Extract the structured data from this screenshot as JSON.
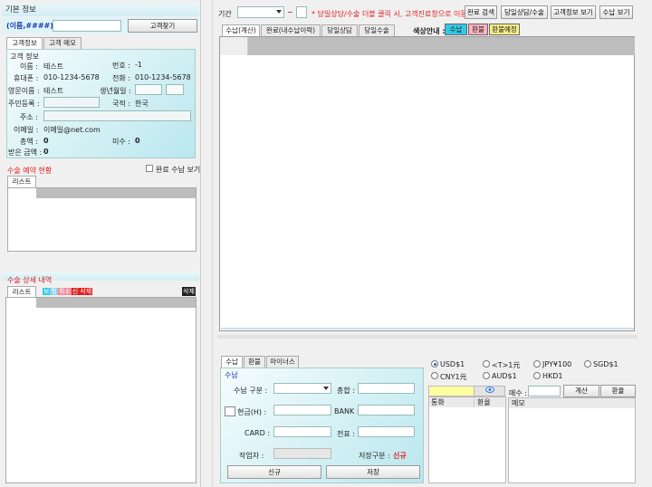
{
  "left": {
    "basic_info_title": "기본 정보",
    "search_placeholder_label": "(이름,####)",
    "customer_search_btn": "고객찾기",
    "tabs": [
      "고객정보",
      "고객 메모"
    ],
    "customer_info_title": "고객 정보",
    "fields": {
      "name_label": "이름 :",
      "name_value": "테스트",
      "no_label": "번호 :",
      "no_value": "-1",
      "mobile_label": "휴대폰 :",
      "mobile_value": "010-1234-5678",
      "phone_label": "전화 :",
      "phone_value": "010-1234-5678",
      "eng_name_label": "영문이름 :",
      "eng_name_value": "테스트",
      "birth_label": "생년월일 :",
      "resident_label": "주민등록 :",
      "nation_label": "국적 :",
      "nation_value": "한국",
      "address_label": "주소 :",
      "email_label": "이메일 :",
      "email_value": "이메일@net.com",
      "total_label": "총액 :",
      "total_value": "0",
      "unpaid_label": "미수 :",
      "unpaid_value": "0",
      "received_label": "받은 금액 :",
      "received_value": "0"
    },
    "reservation_title": "수술 예약 현황",
    "show_completed_label": "완료 수납 보기",
    "list_tab": "리스트",
    "detail_title": "수술 상세 내역",
    "detail_tab": "리스트",
    "detail_tags": [
      "보",
      "험",
      "취소",
      "신",
      "삭제"
    ],
    "detail_right_tag": "삭제"
  },
  "toolbar": {
    "period_label": "기간",
    "tilde": "~",
    "notice": "* 당일상담/수술 더블 클릭 시, 고객진료창으로 이동",
    "buttons": [
      "완료 검색",
      "당일상담/수술",
      "고객정보 보기",
      "수납 보기"
    ]
  },
  "main": {
    "tabs": [
      "수납(계산)",
      "완료(내수납이력)",
      "당일상담",
      "당일수술"
    ],
    "color_legend_label": "색상안내 :",
    "legend": [
      {
        "label": "수납",
        "color": "#33c8e6"
      },
      {
        "label": "환불",
        "color": "#ffb3c1"
      },
      {
        "label": "환불예정",
        "color": "#f5f08a"
      }
    ]
  },
  "payment": {
    "tabs": [
      "수납",
      "환불",
      "마이너스"
    ],
    "section_title": "수납",
    "type_label": "수납 구분 :",
    "total_label": "총합 :",
    "cash_label": "현금(H) :",
    "bank_label": "BANK :",
    "card_label": "CARD :",
    "slip_label": "전표 :",
    "writer_label": "작업자 :",
    "save_type_label": "저장구분 :",
    "save_type_value": "신규",
    "new_btn": "신규",
    "save_btn": "저장"
  },
  "currency": {
    "options": [
      {
        "label": "USD$1",
        "selected": true
      },
      {
        "label": "<T>1元",
        "selected": false
      },
      {
        "label": "JPY¥100",
        "selected": false
      },
      {
        "label": "SGD$1",
        "selected": false
      },
      {
        "label": "CNY1元",
        "selected": false
      },
      {
        "label": "AUD$1",
        "selected": false
      },
      {
        "label": "HKD1",
        "selected": false
      }
    ],
    "grid_cols": [
      "통화",
      "환율"
    ],
    "rate_label": "매수 :",
    "calc_btn": "계산",
    "rate_btn": "환율",
    "memo_label": "메모"
  },
  "colors": {
    "accent_red": "#e02020",
    "panel_cyan": "#c9eef3",
    "header_gray": "#bdbdbd"
  }
}
